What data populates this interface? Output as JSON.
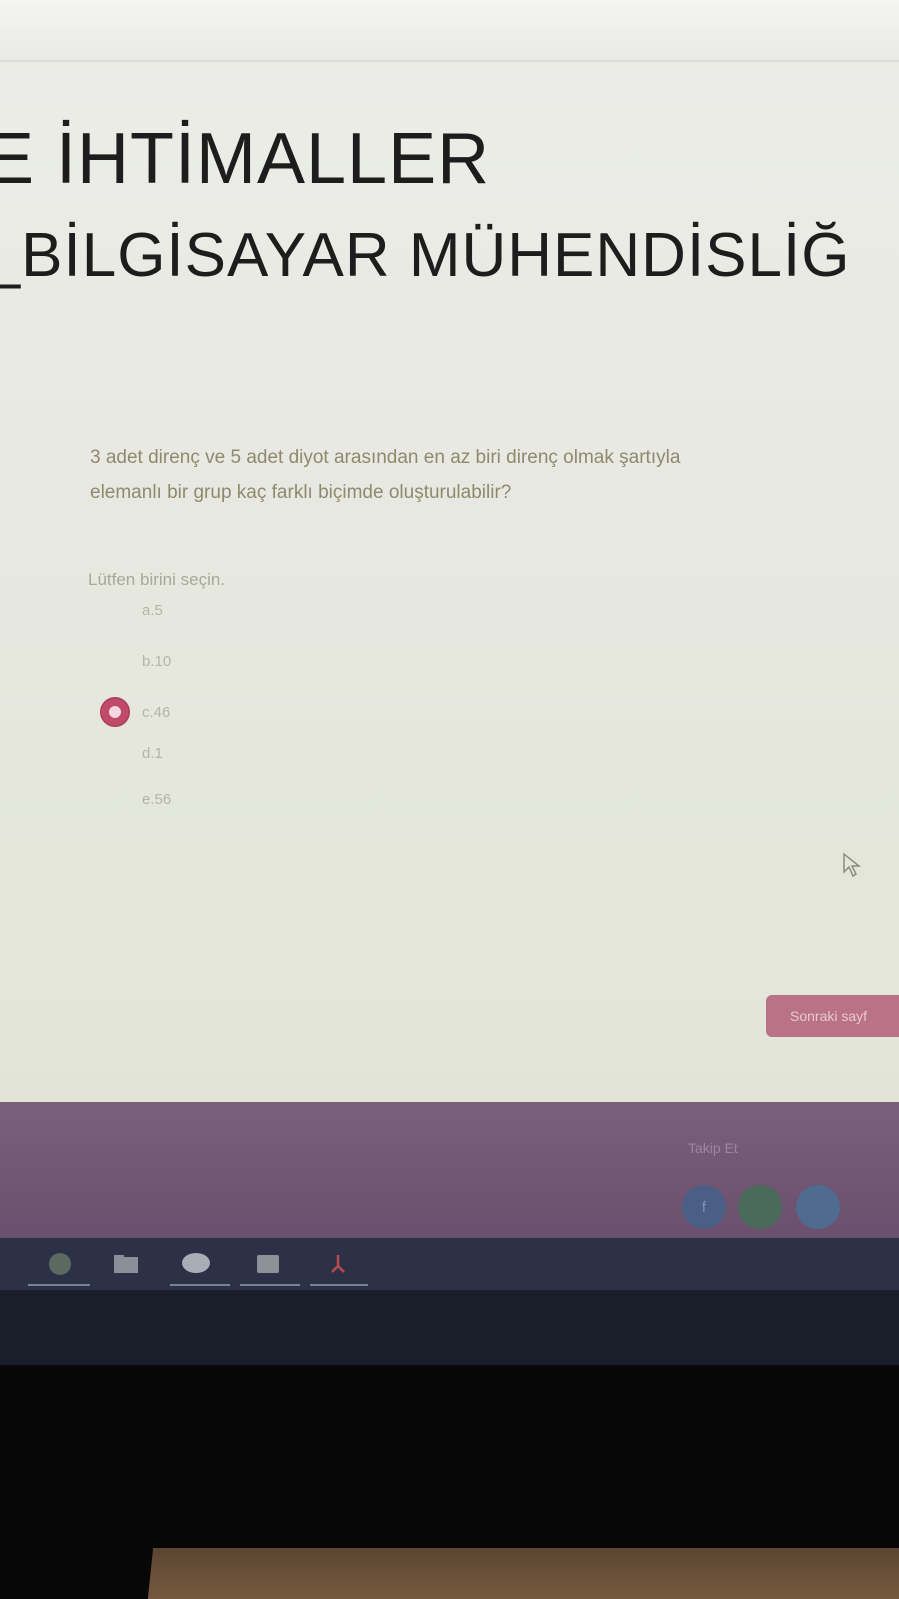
{
  "course": {
    "title_line1": "E İHTİMALLER",
    "title_line2": ")_BİLGİSAYAR MÜHENDİSLİĞ"
  },
  "question": {
    "text_line1": "3 adet direnç ve 5 adet diyot arasından en az biri direnç olmak şartıyla",
    "text_line2": "elemanlı bir grup kaç farklı biçimde oluşturulabilir?",
    "prompt": "Lütfen birini seçin.",
    "options": [
      {
        "label": "a.5",
        "selected": false
      },
      {
        "label": "b.10",
        "selected": false
      },
      {
        "label": "c.46",
        "selected": true
      },
      {
        "label": "d.1",
        "selected": false
      },
      {
        "label": "e.56",
        "selected": false
      }
    ]
  },
  "navigation": {
    "next_label": "Sonraki sayf"
  },
  "footer": {
    "link_label": "Takip Et",
    "social_icons": [
      "facebook-icon",
      "social-icon",
      "social-icon"
    ]
  },
  "taskbar": {
    "icons": [
      "browser-icon",
      "folder-icon",
      "chat-icon",
      "app-icon",
      "pdf-icon"
    ]
  },
  "colors": {
    "accent": "#c1496a",
    "footer": "#6a4f6e",
    "taskbar": "#2c3148"
  }
}
